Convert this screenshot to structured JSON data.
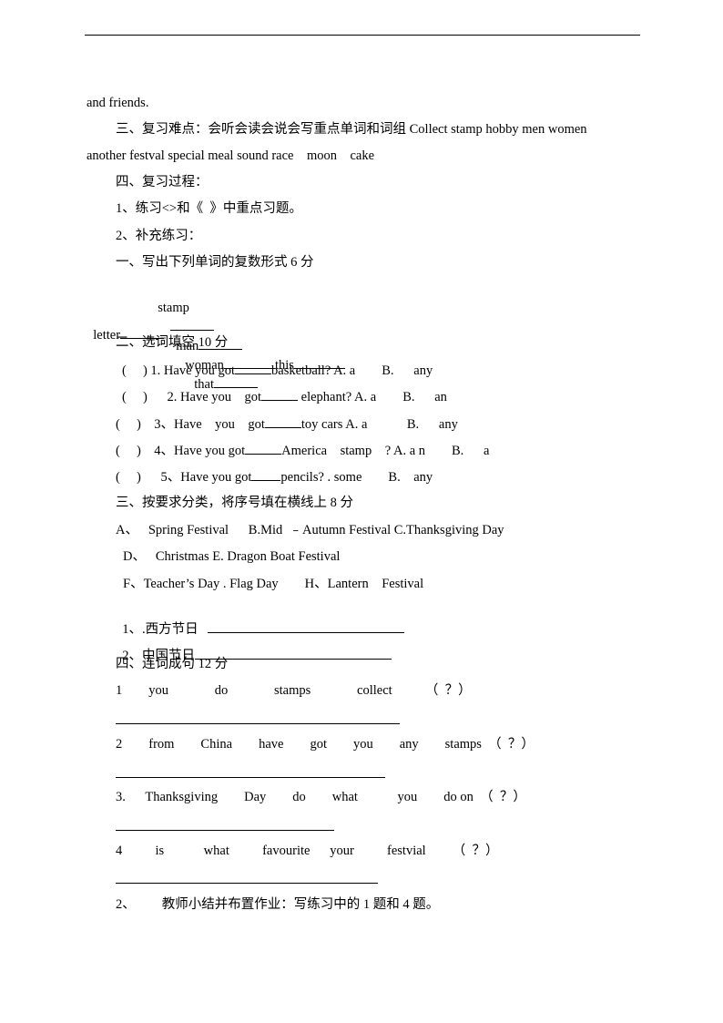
{
  "lines": {
    "l01": "and friends.",
    "l02": "三、复习难点：会听会读会说会写重点单词和词组 Collect stamp hobby men women",
    "l03": "another festval special meal sound race    moon    cake",
    "l04": "四、复习过程：",
    "l05": "1、练习<>和《  》中重点习题。",
    "l06": "2、补充练习：",
    "l07": "一、写出下列单词的复数形式 6 分",
    "l08_a": "stamp",
    "l08_b": "man",
    "l08_c": "woman",
    "l08_d": "this",
    "l08_e": "that",
    "l09": "letter",
    "l10": "二、选词填空 10 分",
    "q1_pre": "(     ) 1. Have you got",
    "q1_post": "basketball? A. a        B.      any",
    "q2_pre": "(     )      2. Have you    got",
    "q2_post": " elephant? A. a        B.      an",
    "q3_pre": "(     )    3、Have    you    got",
    "q3_post": "toy cars A. a            B.      any",
    "q4_pre": "(     )    4、Have you got",
    "q4_post": "America    stamp    ? A. a n        B.      a",
    "q5_pre": "(     )      5、Have you got",
    "q5_post": "pencils? . some        B.    any",
    "l16": "三、按要求分类，将序号填在横线上 8 分",
    "l17": "A、   Spring Festival      B.Mid  ﹣Autumn Festival C.Thanksgiving Day",
    "l18": "D、   Christmas E. Dragon Boat Festival",
    "l19": "F、Teacher’s Day . Flag Day        H、Lantern    Festival",
    "l20": "1、.西方节日",
    "l21": "2、中国节日",
    "l22": "四、连词成句 12 分",
    "s1": "1        you              do              stamps              collect          （  ？）",
    "s2": "2        from        China        have        got        you        any        stamps  （  ？）",
    "s3": "3.      Thanksgiving        Day        do        what            you        do on  （  ？）",
    "s4": "4          is            what          favourite      your          festvial        （  ？）",
    "l27": "2、        教师小结并布置作业：写练习中的 1 题和 4 题。"
  }
}
